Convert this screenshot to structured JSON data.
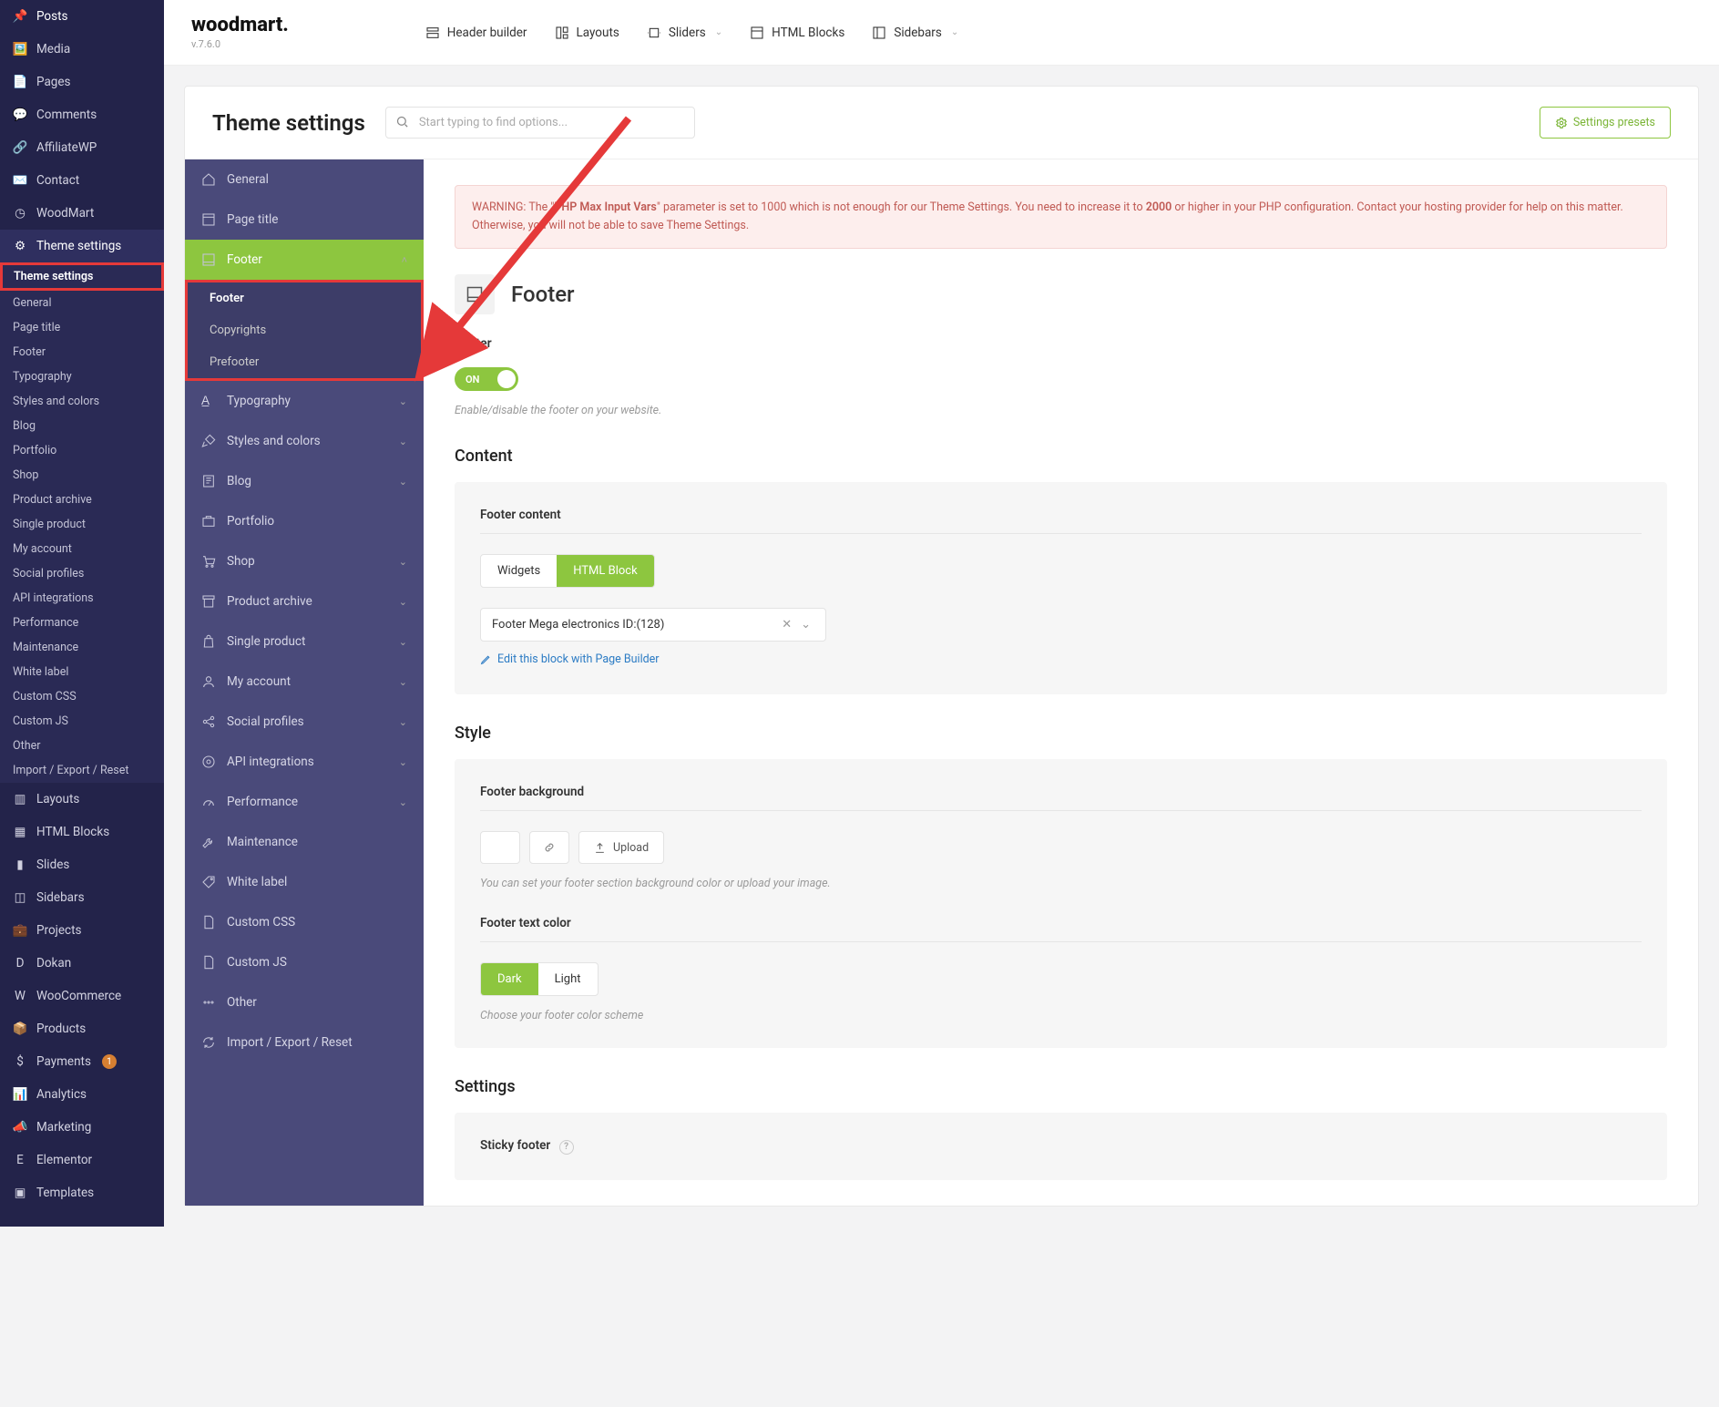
{
  "wp_menu": {
    "posts": "Posts",
    "media": "Media",
    "pages": "Pages",
    "comments": "Comments",
    "affiliatewp": "AffiliateWP",
    "contact": "Contact",
    "woodmart": "WoodMart",
    "theme_settings": "Theme settings",
    "sub": {
      "theme_settings": "Theme settings",
      "general": "General",
      "page_title": "Page title",
      "footer": "Footer",
      "typography": "Typography",
      "styles_colors": "Styles and colors",
      "blog": "Blog",
      "portfolio": "Portfolio",
      "shop": "Shop",
      "product_archive": "Product archive",
      "single_product": "Single product",
      "my_account": "My account",
      "social_profiles": "Social profiles",
      "api_integrations": "API integrations",
      "performance": "Performance",
      "maintenance": "Maintenance",
      "white_label": "White label",
      "custom_css": "Custom CSS",
      "custom_js": "Custom JS",
      "other": "Other",
      "import_export": "Import / Export / Reset"
    },
    "layouts": "Layouts",
    "html_blocks": "HTML Blocks",
    "slides": "Slides",
    "sidebars": "Sidebars",
    "projects": "Projects",
    "dokan": "Dokan",
    "woocommerce": "WooCommerce",
    "products": "Products",
    "payments": "Payments",
    "payments_badge": "1",
    "analytics": "Analytics",
    "marketing": "Marketing",
    "elementor": "Elementor",
    "templates": "Templates"
  },
  "brand": {
    "name": "woodmart.",
    "version": "v.7.6.0"
  },
  "topnav": {
    "header_builder": "Header builder",
    "layouts": "Layouts",
    "sliders": "Sliders",
    "html_blocks": "HTML Blocks",
    "sidebars": "Sidebars"
  },
  "head": {
    "title": "Theme settings",
    "search_ph": "Start typing to find options...",
    "presets": "Settings presets"
  },
  "settings_nav": {
    "general": "General",
    "page_title": "Page title",
    "footer": "Footer",
    "footer_sub": {
      "footer": "Footer",
      "copyrights": "Copyrights",
      "prefooter": "Prefooter"
    },
    "typography": "Typography",
    "styles_colors": "Styles and colors",
    "blog": "Blog",
    "portfolio": "Portfolio",
    "shop": "Shop",
    "product_archive": "Product archive",
    "single_product": "Single product",
    "my_account": "My account",
    "social_profiles": "Social profiles",
    "api_integrations": "API integrations",
    "performance": "Performance",
    "maintenance": "Maintenance",
    "white_label": "White label",
    "custom_css": "Custom CSS",
    "custom_js": "Custom JS",
    "other": "Other",
    "import_export": "Import / Export / Reset"
  },
  "alert": {
    "pre": "WARNING: The \"",
    "b1": "PHP Max Input Vars",
    "mid": "\" parameter is set to 1000 which is not enough for our Theme Settings. You need to increase it to ",
    "b2": "2000",
    "post": " or higher in your PHP configuration. Contact your hosting provider for help on this matter. Otherwise, you will not be able to save Theme Settings."
  },
  "page": {
    "title": "Footer",
    "footer_label": "Footer",
    "toggle_on": "ON",
    "footer_help": "Enable/disable the footer on your website.",
    "content_h": "Content",
    "content_label": "Footer content",
    "tab_widgets": "Widgets",
    "tab_html": "HTML Block",
    "select_value": "Footer Mega electronics ID:(128)",
    "edit_link": "Edit this block with Page Builder",
    "style_h": "Style",
    "bg_label": "Footer background",
    "upload": "Upload",
    "bg_help": "You can set your footer section background color or upload your image.",
    "textcolor_label": "Footer text color",
    "dark": "Dark",
    "light": "Light",
    "textcolor_help": "Choose your footer color scheme",
    "settings_h": "Settings",
    "sticky_label": "Sticky footer"
  }
}
